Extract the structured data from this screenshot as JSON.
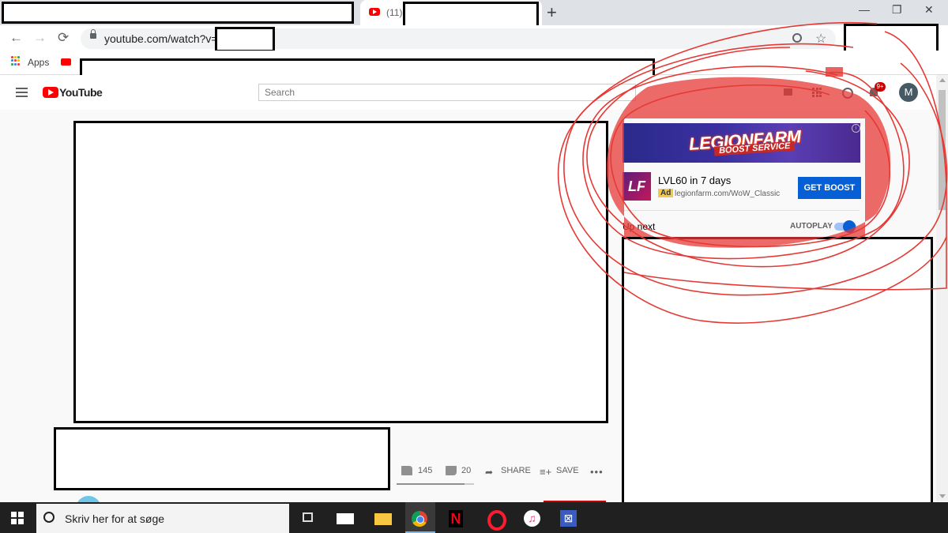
{
  "browser": {
    "tab_count": "(11)",
    "new_tab": "+",
    "window_controls": {
      "minimize": "—",
      "restore": "❐",
      "close": "✕"
    },
    "nav": {
      "back": "←",
      "forward": "→",
      "reload": "⟳"
    },
    "url": "youtube.com/watch?v=",
    "bookmarks": {
      "apps_label": "Apps"
    }
  },
  "youtube": {
    "logo_text": "YouTube",
    "search_placeholder": "Search",
    "notification_badge": "9+",
    "avatar_initial": "M"
  },
  "ad": {
    "banner_title": "LEGIONFARM",
    "banner_subtitle": "BOOST SERVICE",
    "info": "i",
    "logo_text": "LF",
    "title": "LVL60 in 7 days",
    "badge": "Ad",
    "domain": "legionfarm.com/WoW_Classic",
    "cta": "GET BOOST"
  },
  "sidebar": {
    "up_next": "Up next",
    "autoplay_label": "AUTOPLAY",
    "autoplay_on": true
  },
  "video_actions": {
    "likes": "145",
    "dislikes": "20",
    "share": "SHARE",
    "save": "SAVE",
    "more": "•••"
  },
  "taskbar": {
    "search_text": "Skriv her for at søge",
    "netflix": "N",
    "itunes": "♫",
    "app": "⊠"
  },
  "colors": {
    "youtube_red": "#ff0000",
    "cta_blue": "#065fd4",
    "annotation_red": "#e53935"
  }
}
